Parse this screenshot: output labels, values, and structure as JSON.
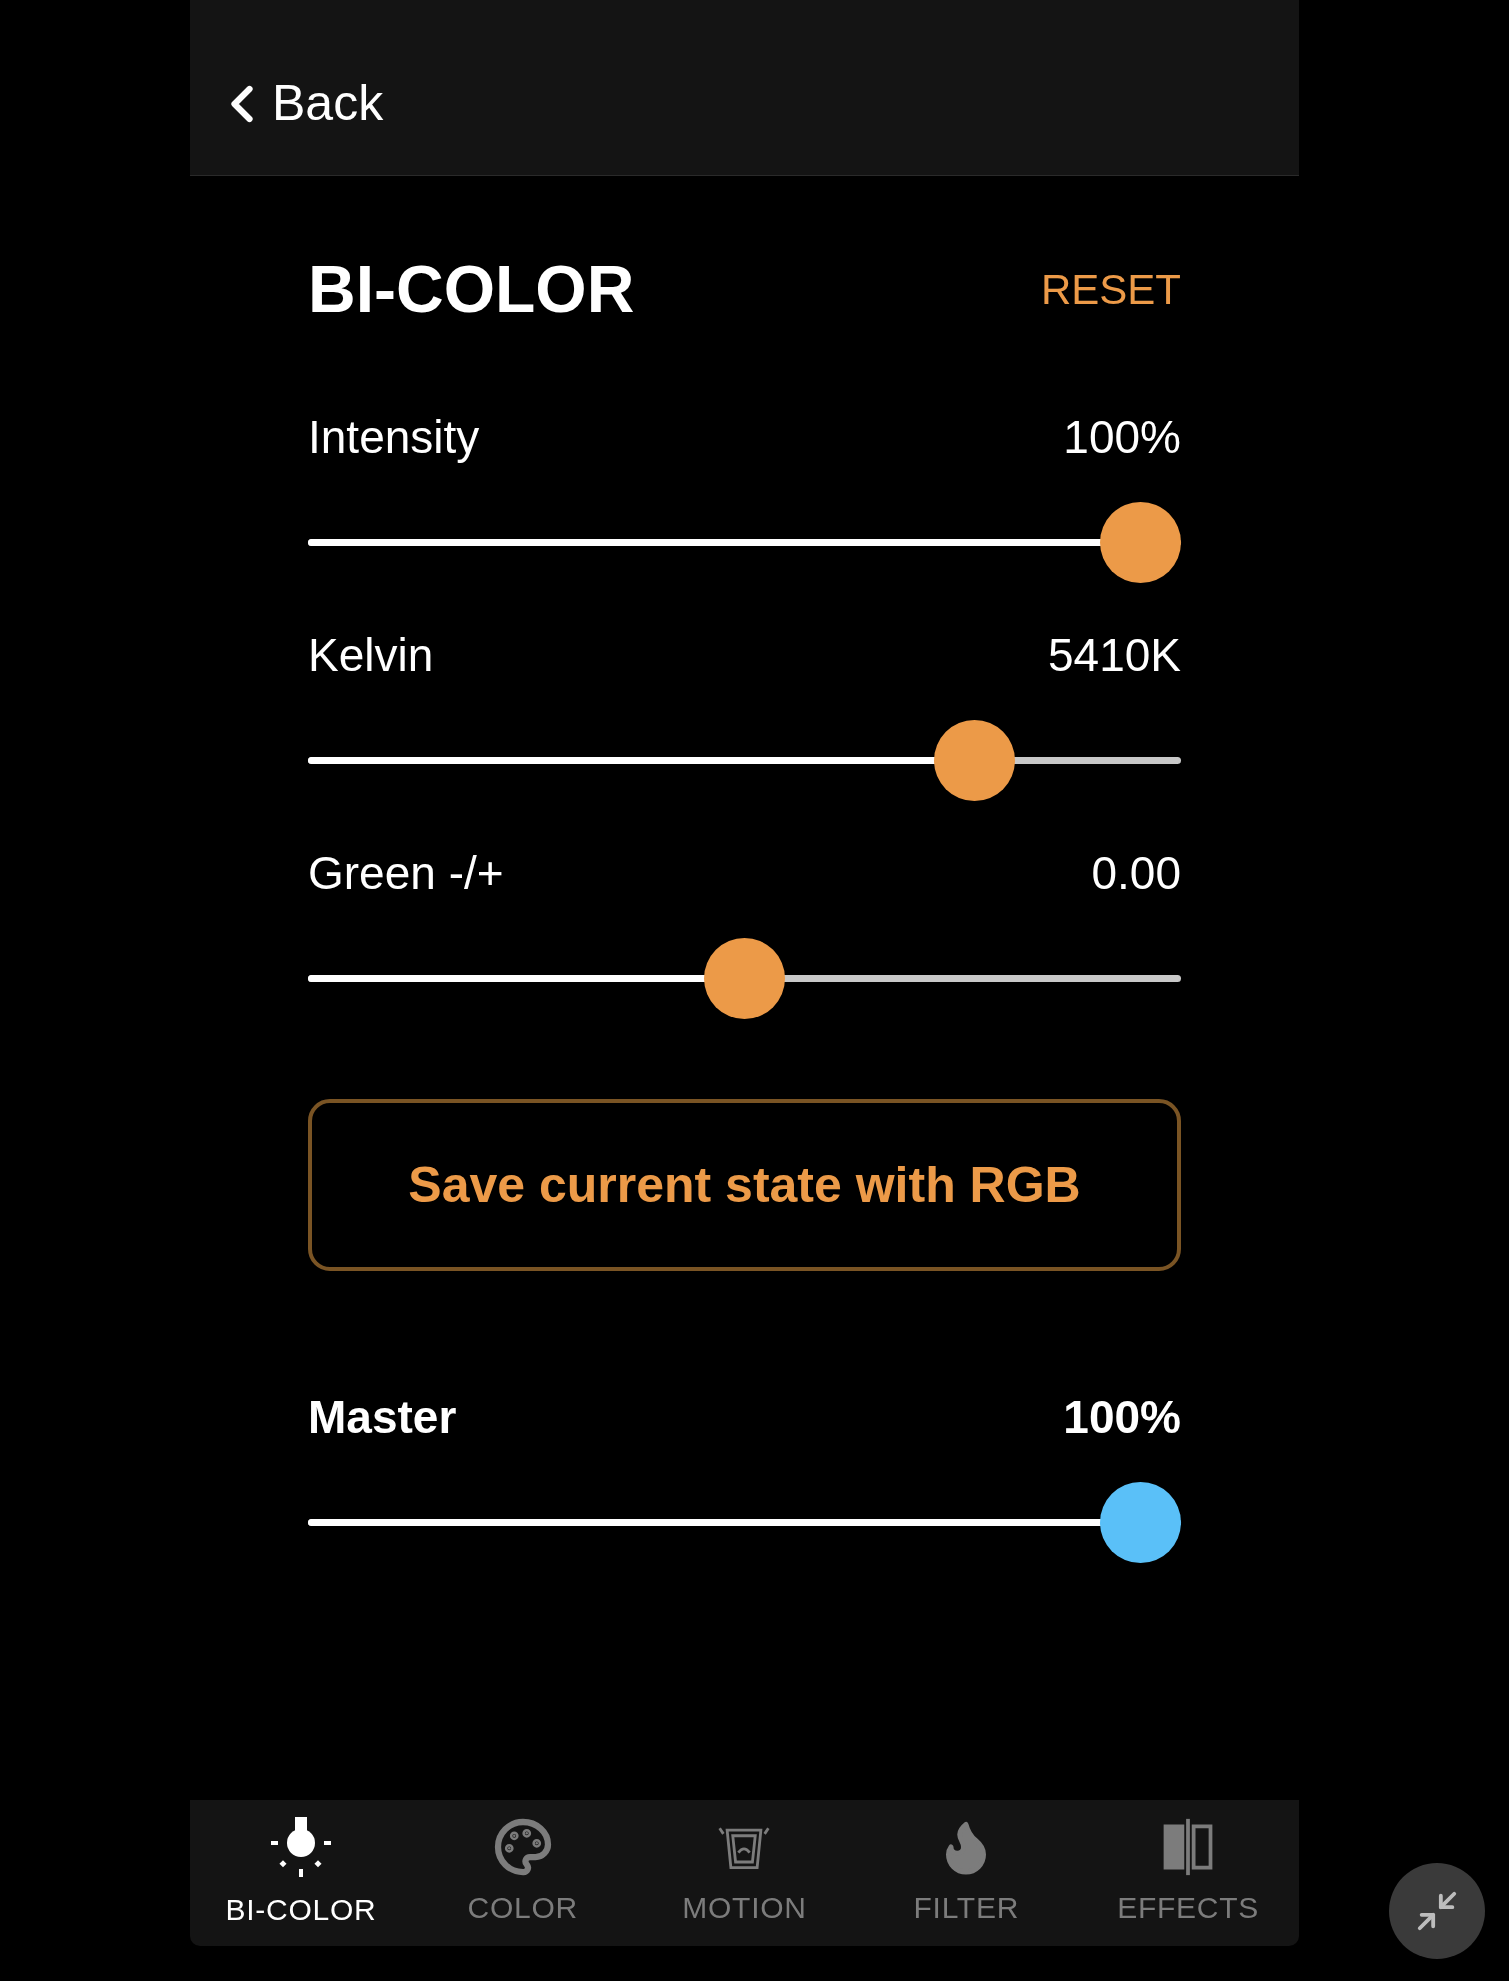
{
  "header": {
    "back_label": "Back"
  },
  "title": "BI-COLOR",
  "reset_label": "RESET",
  "sliders": [
    {
      "label": "Intensity",
      "reading": "100%",
      "level": 1.0,
      "kind": "accent"
    },
    {
      "label": "Kelvin",
      "reading": "5410K",
      "level": 0.79,
      "kind": "accent"
    },
    {
      "label": "Green -/+",
      "reading": "0.00",
      "level": 0.5,
      "kind": "accent"
    }
  ],
  "save_button": "Save current state with RGB",
  "master": {
    "label": "Master",
    "reading": "100%",
    "level": 1.0,
    "kind": "master"
  },
  "tabs": [
    {
      "label": "BI-COLOR",
      "kind": "bulb",
      "selected": true
    },
    {
      "label": "COLOR",
      "kind": "palette",
      "selected": false
    },
    {
      "label": "MOTION",
      "kind": "motion",
      "selected": false
    },
    {
      "label": "FILTER",
      "kind": "flame",
      "selected": false
    },
    {
      "label": "EFFECTS",
      "kind": "effects",
      "selected": false
    }
  ]
}
